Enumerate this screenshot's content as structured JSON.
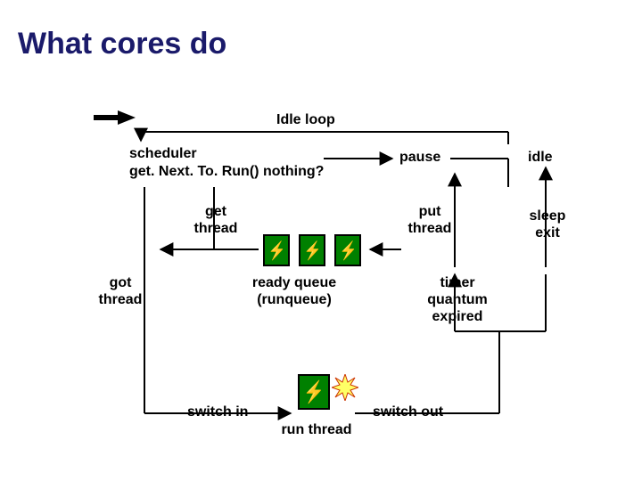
{
  "title": "What cores do",
  "labels": {
    "idle_loop": "Idle loop",
    "scheduler": "scheduler",
    "getnext": "get. Next. To. Run()",
    "nothing": "nothing?",
    "pause": "pause",
    "idle": "idle",
    "get_thread1": "get",
    "get_thread2": "thread",
    "put_thread1": "put",
    "put_thread2": "thread",
    "sleep": "sleep",
    "exit": "exit",
    "got_thread1": "got",
    "got_thread2": "thread",
    "ready_queue1": "ready queue",
    "ready_queue2": "(runqueue)",
    "timer1": "timer",
    "timer2": "quantum",
    "timer3": "expired",
    "switch_in": "switch in",
    "switch_out": "switch out",
    "run_thread": "run thread"
  }
}
